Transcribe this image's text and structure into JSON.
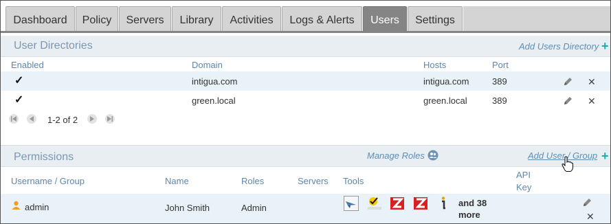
{
  "tabs": [
    {
      "label": "Dashboard"
    },
    {
      "label": "Policy"
    },
    {
      "label": "Servers"
    },
    {
      "label": "Library"
    },
    {
      "label": "Activities"
    },
    {
      "label": "Logs & Alerts"
    },
    {
      "label": "Users"
    },
    {
      "label": "Settings"
    }
  ],
  "active_tab": "Users",
  "directories": {
    "title": "User Directories",
    "add_label": "Add Users Directory",
    "headers": {
      "enabled": "Enabled",
      "domain": "Domain",
      "hosts": "Hosts",
      "port": "Port"
    },
    "rows": [
      {
        "enabled": "✓",
        "domain": "intigua.com",
        "hosts": "intigua.com",
        "port": "389"
      },
      {
        "enabled": "✓",
        "domain": "green.local",
        "hosts": "green.local",
        "port": "389"
      }
    ],
    "pager_text": "1-2 of 2"
  },
  "permissions": {
    "title": "Permissions",
    "manage_roles_label": "Manage Roles",
    "add_label": "Add User / Group",
    "headers": {
      "username": "Username / Group",
      "name": "Name",
      "roles": "Roles",
      "servers": "Servers",
      "tools": "Tools",
      "api_key_line1": "API",
      "api_key_line2": "Key"
    },
    "rows": [
      {
        "username": "admin",
        "name": "John Smith",
        "roles": "Admin",
        "servers": "",
        "more_line1": "and 38",
        "more_line2": "more"
      }
    ]
  },
  "colors": {
    "accent": "#858585",
    "tab_bg": "#d4d4d4",
    "link": "#5a8fb8",
    "plus": "#22aaaa",
    "row_alt": "#e9f1f9"
  }
}
